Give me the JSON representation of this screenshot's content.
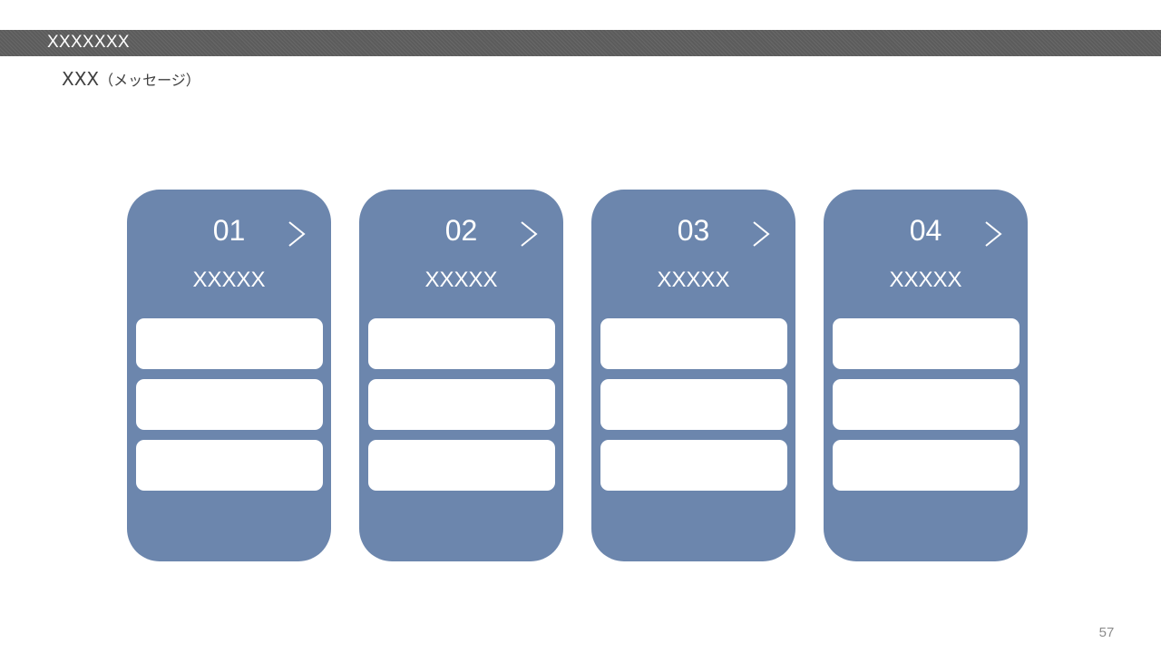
{
  "header": {
    "title": "XXXXXXX",
    "subtitle_main": "XXX",
    "subtitle_paren": "（メッセージ）"
  },
  "cards": [
    {
      "number": "01",
      "label": "XXXXX",
      "icon": "chevron-right-icon"
    },
    {
      "number": "02",
      "label": "XXXXX",
      "icon": "chevron-right-icon"
    },
    {
      "number": "03",
      "label": "XXXXX",
      "icon": "chevron-right-icon"
    },
    {
      "number": "04",
      "label": "XXXXX",
      "icon": "chevron-right-icon"
    }
  ],
  "footer": {
    "page_number": "57"
  },
  "colors": {
    "title_bar": "#5c5c5c",
    "card": "#6c86ad",
    "slot": "#ffffff",
    "text_dark": "#404040",
    "page_number": "#8c8c8c"
  }
}
